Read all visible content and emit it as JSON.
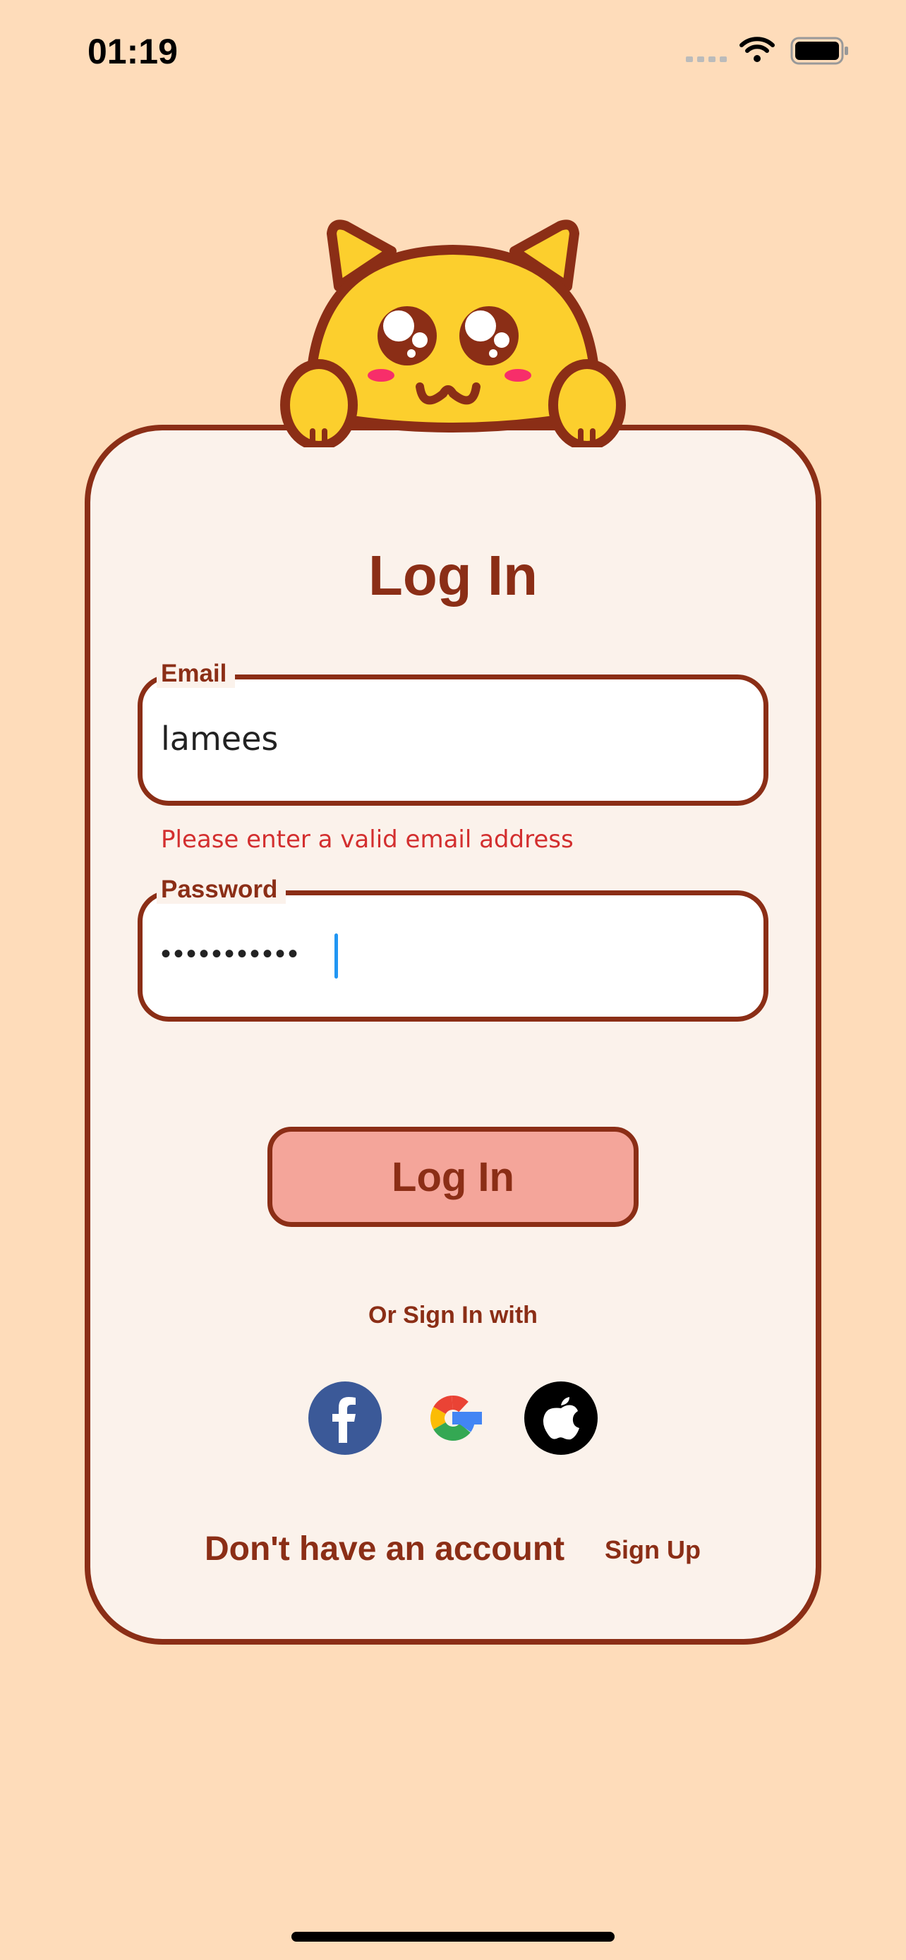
{
  "status_bar": {
    "time": "01:19"
  },
  "login": {
    "title": "Log In",
    "email": {
      "label": "Email",
      "value": "lamees",
      "error": "Please enter a valid email address"
    },
    "password": {
      "label": "Password",
      "value": "•••••••••••"
    },
    "submit_label": "Log In",
    "alt_signin_label": "Or Sign In with",
    "social": [
      "facebook",
      "google",
      "apple"
    ],
    "no_account_text": "Don't have an account",
    "signup_label": "Sign Up"
  },
  "colors": {
    "brand": "#8B2E16",
    "background": "#FEDCBA",
    "button": "#F4A59A",
    "error": "#D32F2F"
  }
}
